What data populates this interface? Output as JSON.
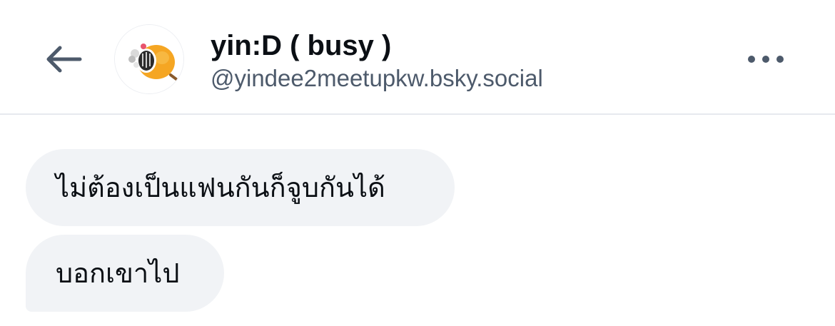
{
  "header": {
    "back_icon": "arrow-left-icon",
    "display_name": "yin:D ( busy )",
    "handle": "@yindee2meetupkw.bsky.social",
    "more_icon": "more-horizontal-icon"
  },
  "messages": [
    {
      "text": "ไม่ต้องเป็นแฟนกันก็จูบกันได้"
    },
    {
      "text": "บอกเขาไป"
    }
  ],
  "colors": {
    "text_primary": "#0b0f14",
    "text_secondary": "#4d5a6b",
    "icon": "#4d5a6b",
    "bubble_bg": "#f1f3f6",
    "divider": "#e6e9ee",
    "avatar_fruit": "#f5a623"
  }
}
